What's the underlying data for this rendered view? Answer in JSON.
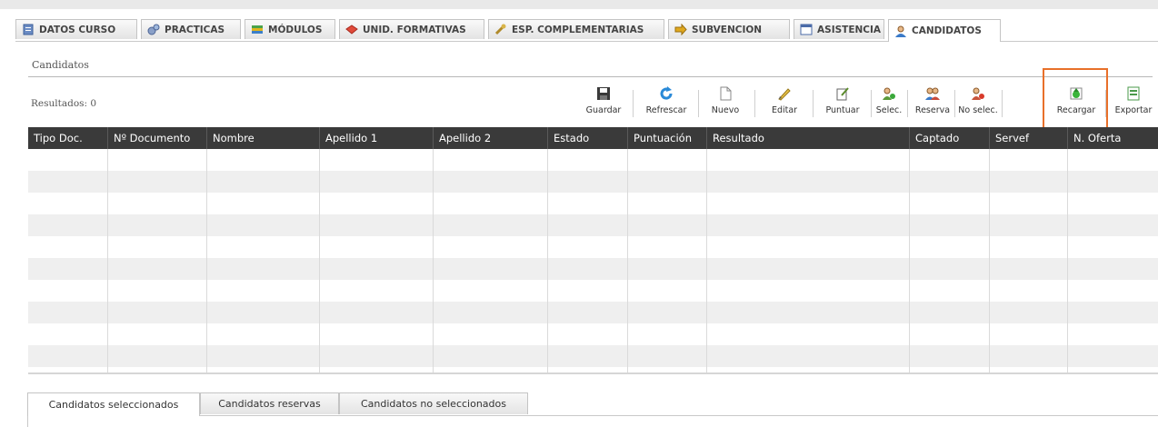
{
  "tabs": [
    {
      "label": "DATOS CURSO",
      "icon": "document-icon"
    },
    {
      "label": "PRACTICAS",
      "icon": "gears-icon"
    },
    {
      "label": "MÓDULOS",
      "icon": "books-icon"
    },
    {
      "label": "UNID. FORMATIVAS",
      "icon": "red-book-icon"
    },
    {
      "label": "ESP. COMPLEMENTARIAS",
      "icon": "wrench-icon"
    },
    {
      "label": "SUBVENCION",
      "icon": "arrow-icon"
    },
    {
      "label": "ASISTENCIA",
      "icon": "calendar-icon"
    },
    {
      "label": "CANDIDATOS",
      "icon": "user-icon"
    }
  ],
  "active_tab": "CANDIDATOS",
  "section_title": "Candidatos",
  "results_label": "Resultados: 0",
  "toolbar": [
    {
      "label": "Guardar",
      "icon": "save-icon"
    },
    {
      "label": "Refrescar",
      "icon": "refresh-icon"
    },
    {
      "label": "Nuevo",
      "icon": "new-document-icon"
    },
    {
      "label": "Editar",
      "icon": "pencil-icon"
    },
    {
      "label": "Puntuar",
      "icon": "score-icon"
    },
    {
      "label": "Selec.",
      "icon": "user-add-icon"
    },
    {
      "label": "Reserva",
      "icon": "users-icon"
    },
    {
      "label": "No selec.",
      "icon": "user-remove-icon"
    },
    {
      "label": "Recargar",
      "icon": "reload-icon"
    },
    {
      "label": "Exportar",
      "icon": "export-icon"
    }
  ],
  "columns": [
    "Tipo Doc.",
    "Nº Documento",
    "Nombre",
    "Apellido 1",
    "Apellido 2",
    "Estado",
    "Puntuación",
    "Resultado",
    "Captado",
    "Servef",
    "N. Oferta"
  ],
  "bottom_tabs": [
    "Candidatos seleccionados",
    "Candidatos reservas",
    "Candidatos no seleccionados"
  ],
  "colors": {
    "highlight": "#e8702a",
    "header_bg": "#3a3a3a",
    "row_alt": "#efefef"
  }
}
